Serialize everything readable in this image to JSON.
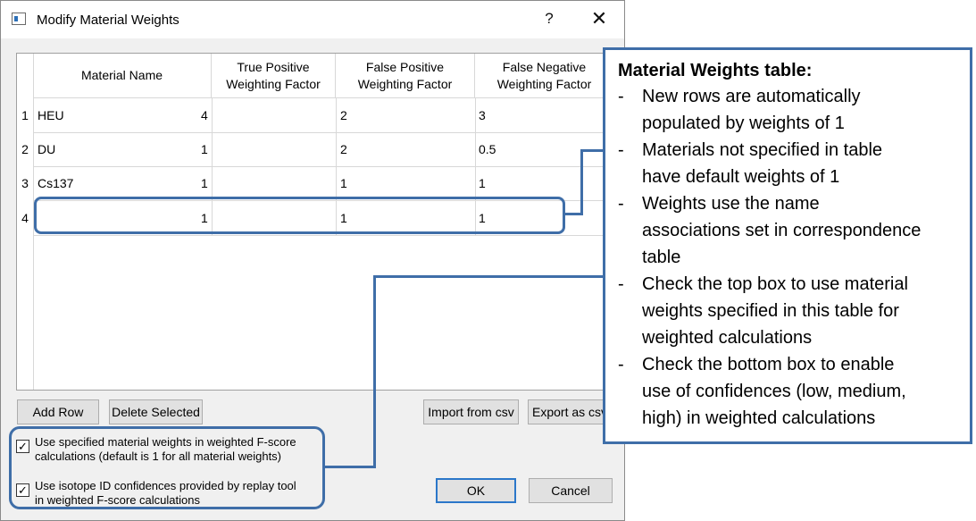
{
  "dialog": {
    "title": "Modify Material Weights",
    "help_label": "?",
    "close_label": "✕"
  },
  "table": {
    "columns": [
      "Material Name",
      "True Positive\nWeighting Factor",
      "False Positive\nWeighting Factor",
      "False Negative\nWeighting Factor"
    ],
    "rows": [
      {
        "index": "1",
        "cells": [
          "HEU",
          "4",
          "2",
          "3"
        ]
      },
      {
        "index": "2",
        "cells": [
          "DU",
          "1",
          "2",
          "0.5"
        ]
      },
      {
        "index": "3",
        "cells": [
          "Cs137",
          "1",
          "1",
          "1"
        ]
      },
      {
        "index": "4",
        "cells": [
          "",
          "1",
          "1",
          "1"
        ]
      }
    ]
  },
  "buttons": {
    "add_row": "Add Row",
    "delete_selected": "Delete Selected",
    "import_csv": "Import from csv",
    "export_csv": "Export as csv",
    "ok": "OK",
    "cancel": "Cancel"
  },
  "options": {
    "use_weights": {
      "checked": true,
      "mark": "✓",
      "label_line1": "Use specified material weights in weighted F-score",
      "label_line2": "calculations (default is 1 for all material weights)"
    },
    "use_confidences": {
      "checked": true,
      "mark": "✓",
      "label_line1": "Use isotope ID confidences provided by replay tool",
      "label_line2": "in weighted F-score calculations"
    }
  },
  "callout": {
    "title": "Material Weights table:",
    "items": [
      [
        "New rows are automatically",
        "populated by weights of 1"
      ],
      [
        "Materials not specified in table",
        "have default weights of 1"
      ],
      [
        "Weights use the name",
        "associations set in correspondence",
        "table"
      ],
      [
        "Check the top box to use material",
        "weights specified in this table for",
        "weighted calculations"
      ],
      [
        "Check the bottom box to enable",
        "use of confidences (low, medium,",
        "high) in weighted calculations"
      ]
    ]
  },
  "colors": {
    "highlight": "#3f6ea8",
    "default_button_border": "#2b77c9"
  }
}
